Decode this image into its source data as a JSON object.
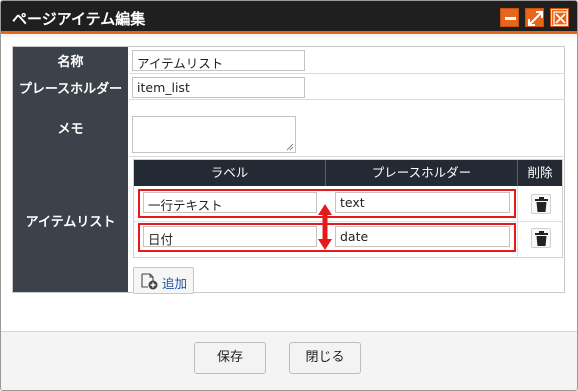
{
  "dialog": {
    "title": "ページアイテム編集",
    "controls": {
      "minimize_icon": "minimize-icon",
      "maximize_icon": "maximize-icon",
      "close_icon": "close-icon"
    }
  },
  "form": {
    "fields": {
      "name": {
        "label": "名称",
        "value": "アイテムリスト"
      },
      "placeholder": {
        "label": "プレースホルダー",
        "value": "item_list"
      },
      "memo": {
        "label": "メモ",
        "value": ""
      },
      "item_list": {
        "label": "アイテムリスト"
      }
    },
    "items_table": {
      "headers": {
        "label": "ラベル",
        "placeholder": "プレースホルダー",
        "delete": "削除"
      },
      "rows": [
        {
          "label": "一行テキスト",
          "placeholder": "text"
        },
        {
          "label": "日付",
          "placeholder": "date"
        }
      ]
    },
    "add_button": {
      "label": "追加",
      "icon": "add-page-icon"
    }
  },
  "footer": {
    "save_label": "保存",
    "close_label": "閉じる"
  },
  "colors": {
    "accent": "#e8661a",
    "titlebar": "#1f1f1f",
    "label_column": "#3c424a",
    "highlight": "#e31b1b"
  }
}
